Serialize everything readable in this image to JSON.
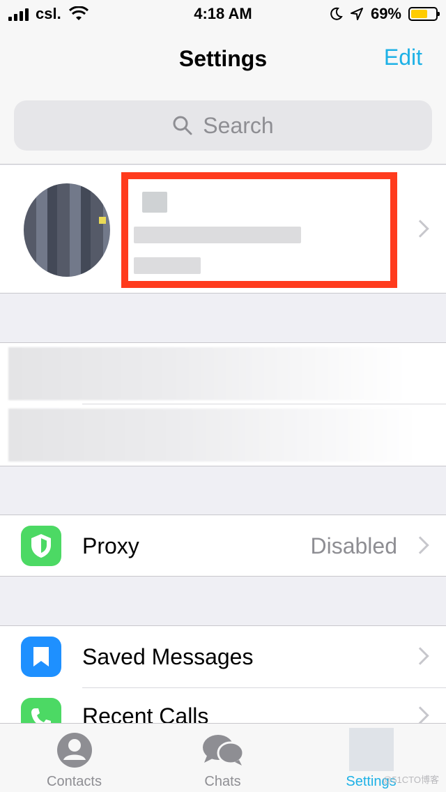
{
  "status_bar": {
    "carrier": "csl.",
    "time": "4:18 AM",
    "battery_percent": "69%",
    "battery_level": 0.69,
    "signal_icon": "signal-bars-icon",
    "wifi_icon": "wifi-icon",
    "moon_icon": "moon-icon",
    "location_icon": "location-arrow-icon"
  },
  "nav": {
    "title": "Settings",
    "edit_label": "Edit"
  },
  "search": {
    "placeholder": "Search",
    "icon": "search-icon"
  },
  "proxy": {
    "label": "Proxy",
    "value": "Disabled",
    "icon": "shield-icon",
    "icon_color": "#4cd964"
  },
  "items": [
    {
      "label": "Saved Messages",
      "icon": "bookmark-icon",
      "icon_color": "#1e90ff"
    },
    {
      "label": "Recent Calls",
      "icon": "phone-icon",
      "icon_color": "#4cd964"
    }
  ],
  "tabs": [
    {
      "label": "Contacts",
      "icon": "person-icon",
      "active": false
    },
    {
      "label": "Chats",
      "icon": "chat-bubbles-icon",
      "active": false
    },
    {
      "label": "Settings",
      "icon": "settings-icon",
      "active": true
    }
  ],
  "watermark": "@51CTO博客",
  "colors": {
    "accent": "#1eb1e6",
    "highlight_box": "#ff3b1d",
    "secondary_text": "#8e8e93"
  }
}
